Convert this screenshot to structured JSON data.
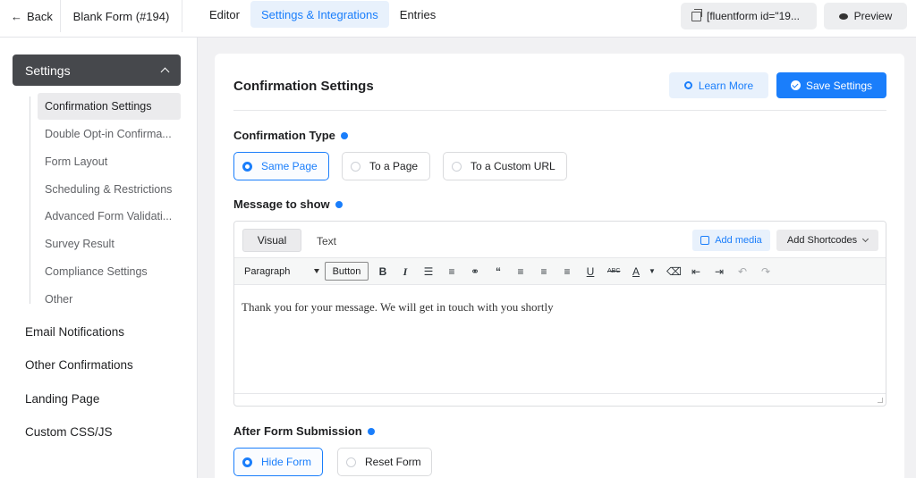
{
  "topbar": {
    "back_label": "Back",
    "form_name": "Blank Form (#194)",
    "tabs": [
      {
        "label": "Editor"
      },
      {
        "label": "Settings & Integrations"
      },
      {
        "label": "Entries"
      }
    ],
    "shortcode": "[fluentform id=\"19...",
    "preview_label": "Preview"
  },
  "sidebar": {
    "header": "Settings",
    "subitems": [
      {
        "label": "Confirmation Settings"
      },
      {
        "label": "Double Opt-in Confirma..."
      },
      {
        "label": "Form Layout"
      },
      {
        "label": "Scheduling & Restrictions"
      },
      {
        "label": "Advanced Form Validati..."
      },
      {
        "label": "Survey Result"
      },
      {
        "label": "Compliance Settings"
      },
      {
        "label": "Other"
      }
    ],
    "main_items": [
      {
        "label": "Email Notifications"
      },
      {
        "label": "Other Confirmations"
      },
      {
        "label": "Landing Page"
      },
      {
        "label": "Custom CSS/JS"
      }
    ]
  },
  "main": {
    "title": "Confirmation Settings",
    "learn_more": "Learn More",
    "save": "Save Settings",
    "confirmation_type": {
      "label": "Confirmation Type",
      "options": [
        {
          "label": "Same Page",
          "selected": true
        },
        {
          "label": "To a Page",
          "selected": false
        },
        {
          "label": "To a Custom URL",
          "selected": false
        }
      ]
    },
    "message": {
      "label": "Message to show",
      "tab_visual": "Visual",
      "tab_text": "Text",
      "add_media": "Add media",
      "add_shortcodes": "Add Shortcodes",
      "format": "Paragraph",
      "button": "Button",
      "content": "Thank you for your message. We will get in touch with you shortly"
    },
    "after_submission": {
      "label": "After Form Submission",
      "options": [
        {
          "label": "Hide Form",
          "selected": true
        },
        {
          "label": "Reset Form",
          "selected": false
        }
      ]
    }
  },
  "colors": {
    "accent": "#1a7efb",
    "sidebar_header": "#46484c"
  }
}
